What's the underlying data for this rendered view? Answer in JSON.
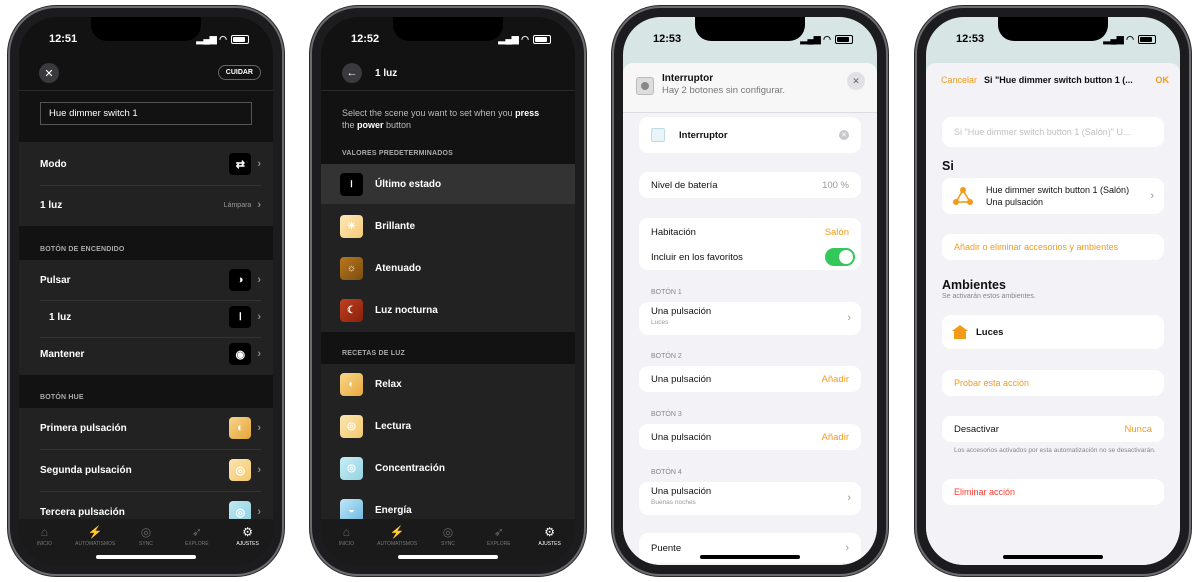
{
  "status_times": [
    "12:51",
    "12:52",
    "12:53",
    "12:53"
  ],
  "colors": {
    "accent": "#f29b18",
    "toggle": "#34c759",
    "dark_bg": "#121212"
  },
  "screen1": {
    "close_icon": "close-icon",
    "save_label": "CUIDAR",
    "name_value": "Hue dimmer switch 1",
    "mode_label": "Modo",
    "light_label": "1 luz",
    "light_value": "Lámpara",
    "power_section": "BOTÓN DE ENCENDIDO",
    "press_label": "Pulsar",
    "sub_light_label": "1 luz",
    "hold_label": "Mantener",
    "hue_section": "BOTÓN HUE",
    "first_press": "Primera pulsación",
    "second_press": "Segunda pulsación",
    "third_press": "Tercera pulsación",
    "tabs": [
      "INICIO",
      "AUTOMATISMOS",
      "SYNC",
      "EXPLORE",
      "AJUSTES"
    ]
  },
  "screen2": {
    "title": "1 luz",
    "intro_a": "Select the scene you want to set when you ",
    "intro_b": "press",
    "intro_c": "the ",
    "intro_d": "power",
    "intro_e": " button",
    "defaults_section": "VALORES PREDETERMINADOS",
    "defaults": [
      "Último estado",
      "Brillante",
      "Atenuado",
      "Luz nocturna"
    ],
    "recipes_section": "RECETAS DE LUZ",
    "recipes": [
      "Relax",
      "Lectura",
      "Concentración",
      "Energía"
    ],
    "tabs": [
      "INICIO",
      "AUTOMATISMOS",
      "SYNC",
      "EXPLORE",
      "AJUSTES"
    ]
  },
  "screen3": {
    "header_title": "Interruptor",
    "header_sub": "Hay 2 botones sin configurar.",
    "name_value": "Interruptor",
    "battery_label": "Nivel de batería",
    "battery_value": "100 %",
    "room_label": "Habitación",
    "room_value": "Salón",
    "fav_label": "Incluir en los favoritos",
    "b1": "BOTÓN 1",
    "b1_action": "Una pulsación",
    "b1_sub": "Luces",
    "b2": "BOTÓN 2",
    "b2_action": "Una pulsación",
    "b2_value": "Añadir",
    "b3": "BOTÓN 3",
    "b3_action": "Una pulsación",
    "b3_value": "Añadir",
    "b4": "BOTÓN 4",
    "b4_action": "Una pulsación",
    "b4_sub": "Buenas noches",
    "bridge_label": "Puente"
  },
  "screen4": {
    "cancel": "Cancelar",
    "title": "Si \"Hue dimmer switch button 1 (...",
    "ok": "OK",
    "name_placeholder": "Si \"Hue dimmer switch button 1 (Salón)\" U...",
    "si_heading": "Si",
    "trigger_line1": "Hue dimmer switch button 1 (Salón)",
    "trigger_line2": "Una pulsación",
    "add_remove": "Añadir o eliminar accesorios y ambientes",
    "scenes_heading": "Ambientes",
    "scenes_sub": "Se activarán estos ambientes.",
    "scene_item": "Luces",
    "test_action": "Probar esta acción",
    "deactivate_label": "Desactivar",
    "deactivate_value": "Nunca",
    "note": "Los accesorios activados por esta automatización no se desactivarán.",
    "delete_action": "Eliminar acción"
  }
}
